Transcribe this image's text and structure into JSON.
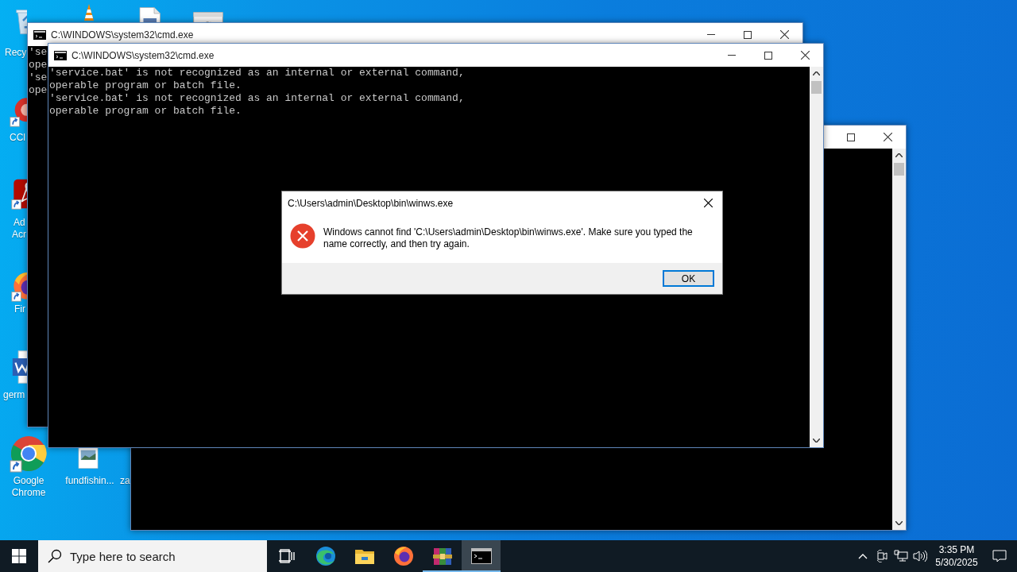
{
  "desktop": {
    "icons": [
      {
        "kind": "recycle",
        "label_lines": [
          "Recy"
        ],
        "shortcut": false
      },
      {
        "kind": "vlc"
      },
      {
        "kind": "document"
      },
      {
        "kind": "settings"
      },
      {
        "kind": "ccleaner",
        "label_lines": [
          "CCl"
        ],
        "shortcut": true
      },
      {
        "kind": "acrobat",
        "label_lines": [
          "Ad",
          "Acr"
        ],
        "shortcut": true
      },
      {
        "kind": "firefox",
        "label_lines": [
          "Fir"
        ],
        "shortcut": true
      },
      {
        "kind": "word",
        "label_lines": [
          "germ"
        ],
        "shortcut": false
      },
      {
        "kind": "chrome",
        "label_lines": [
          "Google",
          "Chrome"
        ],
        "shortcut": true
      },
      {
        "kind": "image",
        "label_lines": [
          "fundfishin..."
        ],
        "shortcut": false
      },
      {
        "label_lines": [
          "za"
        ]
      }
    ]
  },
  "windows": [
    {
      "kind": "console"
    },
    {
      "kind": "console",
      "title": "C:\\WINDOWS\\system32\\cmd.exe",
      "console_lines": [
        "'se",
        "ope",
        "'se",
        "ope"
      ]
    },
    {
      "kind": "console",
      "title": "C:\\WINDOWS\\system32\\cmd.exe",
      "console_lines": [
        "'service.bat' is not recognized as an internal or external command,",
        "operable program or batch file.",
        "'service.bat' is not recognized as an internal or external command,",
        "operable program or batch file."
      ]
    }
  ],
  "dialog": {
    "title": "C:\\Users\\admin\\Desktop\\bin\\winws.exe",
    "message": "Windows cannot find 'C:\\Users\\admin\\Desktop\\bin\\winws.exe'. Make sure you typed the name correctly, and then try again.",
    "buttons": [
      {
        "label": "OK",
        "default": true
      }
    ]
  },
  "taskbar": {
    "search": {
      "placeholder": "Type here to search"
    },
    "apps": [
      {
        "kind": "task-view",
        "running": false,
        "active": false
      },
      {
        "kind": "edge",
        "running": false,
        "active": false
      },
      {
        "kind": "explorer",
        "running": false,
        "active": false
      },
      {
        "kind": "firefox",
        "running": false,
        "active": false
      },
      {
        "kind": "winrar",
        "running": true,
        "active": false
      },
      {
        "kind": "cmd",
        "running": true,
        "active": true
      }
    ],
    "tray": [
      {
        "kind": "chevron"
      },
      {
        "kind": "meet"
      },
      {
        "kind": "network"
      },
      {
        "kind": "volume"
      }
    ],
    "clock": {
      "time": "3:35 PM",
      "date": "5/30/2025"
    }
  }
}
